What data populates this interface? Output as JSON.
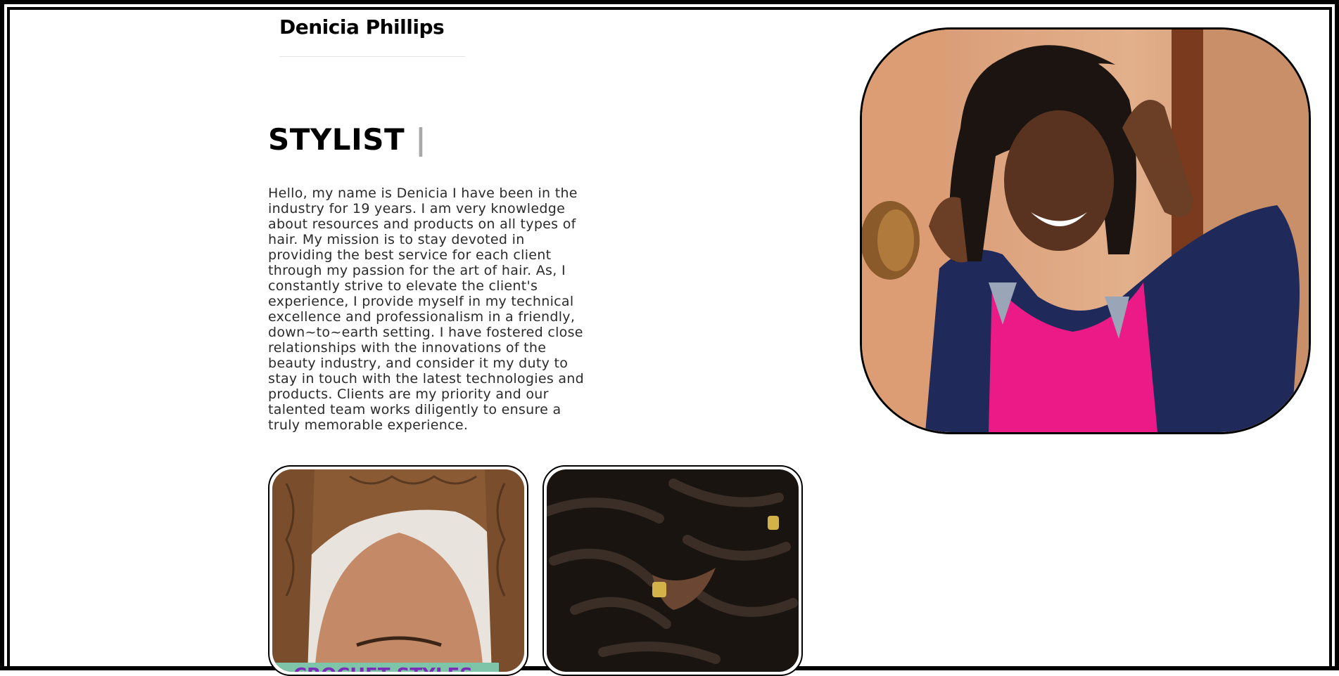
{
  "header": {
    "name": "Denicia Phillips"
  },
  "hero": {
    "role": "STYLIST",
    "cursor": "|",
    "bio": "Hello, my name is Denicia I have been in the industry for 19 years. I am very knowledge about resources and products on all types of hair. My mission is to stay devoted in providing the best service for each client through my passion for the art of hair. As, I constantly strive to elevate the client's experience, I provide myself in my technical excellence and professionalism in a friendly, down~to~earth setting. I have fostered close relationships with the innovations of the beauty industry, and consider it my duty to stay in touch with the latest technologies and products. Clients are my priority and our talented team works diligently to ensure a truly memorable experience."
  },
  "gallery": {
    "cards": [
      {
        "label": "CROCHET STYLES"
      },
      {
        "label": ""
      }
    ]
  },
  "colors": {
    "frame": "#000000",
    "label_bg": "#7ec4a8",
    "label_text": "#7b2db8",
    "cursor": "#a8a8a8"
  }
}
